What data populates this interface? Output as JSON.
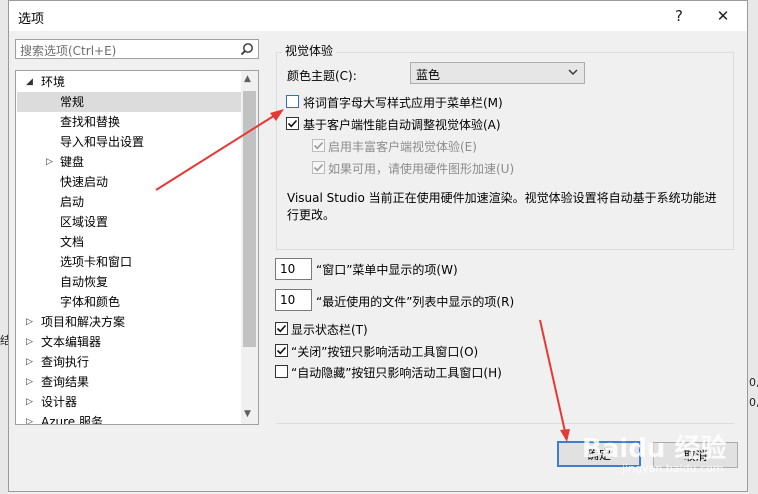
{
  "window": {
    "title": "选项",
    "help_label": "?",
    "close_label": "✕"
  },
  "search": {
    "placeholder": "搜索选项(Ctrl+E)"
  },
  "tree": {
    "items": [
      {
        "label": "环境",
        "expanded": true
      },
      {
        "label": "常规",
        "selected": true
      },
      {
        "label": "查找和替换"
      },
      {
        "label": "导入和导出设置"
      },
      {
        "label": "键盘",
        "expandable": true
      },
      {
        "label": "快速启动"
      },
      {
        "label": "启动"
      },
      {
        "label": "区域设置"
      },
      {
        "label": "文档"
      },
      {
        "label": "选项卡和窗口"
      },
      {
        "label": "自动恢复"
      },
      {
        "label": "字体和颜色"
      },
      {
        "label": "项目和解决方案",
        "expandable": true
      },
      {
        "label": "文本编辑器",
        "expandable": true
      },
      {
        "label": "查询执行",
        "expandable": true
      },
      {
        "label": "查询结果",
        "expandable": true
      },
      {
        "label": "设计器",
        "expandable": true
      },
      {
        "label": "Azure 服务",
        "expandable": true
      }
    ]
  },
  "visual": {
    "group_title": "视觉体验",
    "theme_label": "颜色主题(C):",
    "theme_value": "蓝色",
    "cb_caps": {
      "label": "将词首字母大写样式应用于菜单栏(M)",
      "checked": false
    },
    "cb_auto": {
      "label": "基于客户端性能自动调整视觉体验(A)",
      "checked": true
    },
    "cb_rich": {
      "label": "启用丰富客户端视觉体验(E)",
      "checked": true,
      "disabled": true
    },
    "cb_hw": {
      "label": "如果可用，请使用硬件图形加速(U)",
      "checked": true,
      "disabled": true
    },
    "info": "Visual Studio 当前正在使用硬件加速渲染。视觉体验设置将自动基于系统功能进行更改。"
  },
  "window_menu": {
    "value": "10",
    "label": "“窗口”菜单中显示的项(W)"
  },
  "mru": {
    "value": "10",
    "label": "“最近使用的文件”列表中显示的项(R)"
  },
  "cb_status": {
    "label": "显示状态栏(T)",
    "checked": true
  },
  "cb_close": {
    "label": "“关闭”按钮只影响活动工具窗口(O)",
    "checked": true
  },
  "cb_autohide": {
    "label": "“自动隐藏”按钮只影响活动工具窗口(H)",
    "checked": false
  },
  "buttons": {
    "ok": "确定",
    "cancel": "取消"
  },
  "background": {
    "left_fragment": "结",
    "right_fragment_1": "0,",
    "right_fragment_2": "0,"
  },
  "watermark": {
    "text": "Baidu 经验",
    "sub": "jingyan.baidu.com"
  },
  "colors": {
    "arrow": "#e53935",
    "accent": "#3c7fd1"
  }
}
